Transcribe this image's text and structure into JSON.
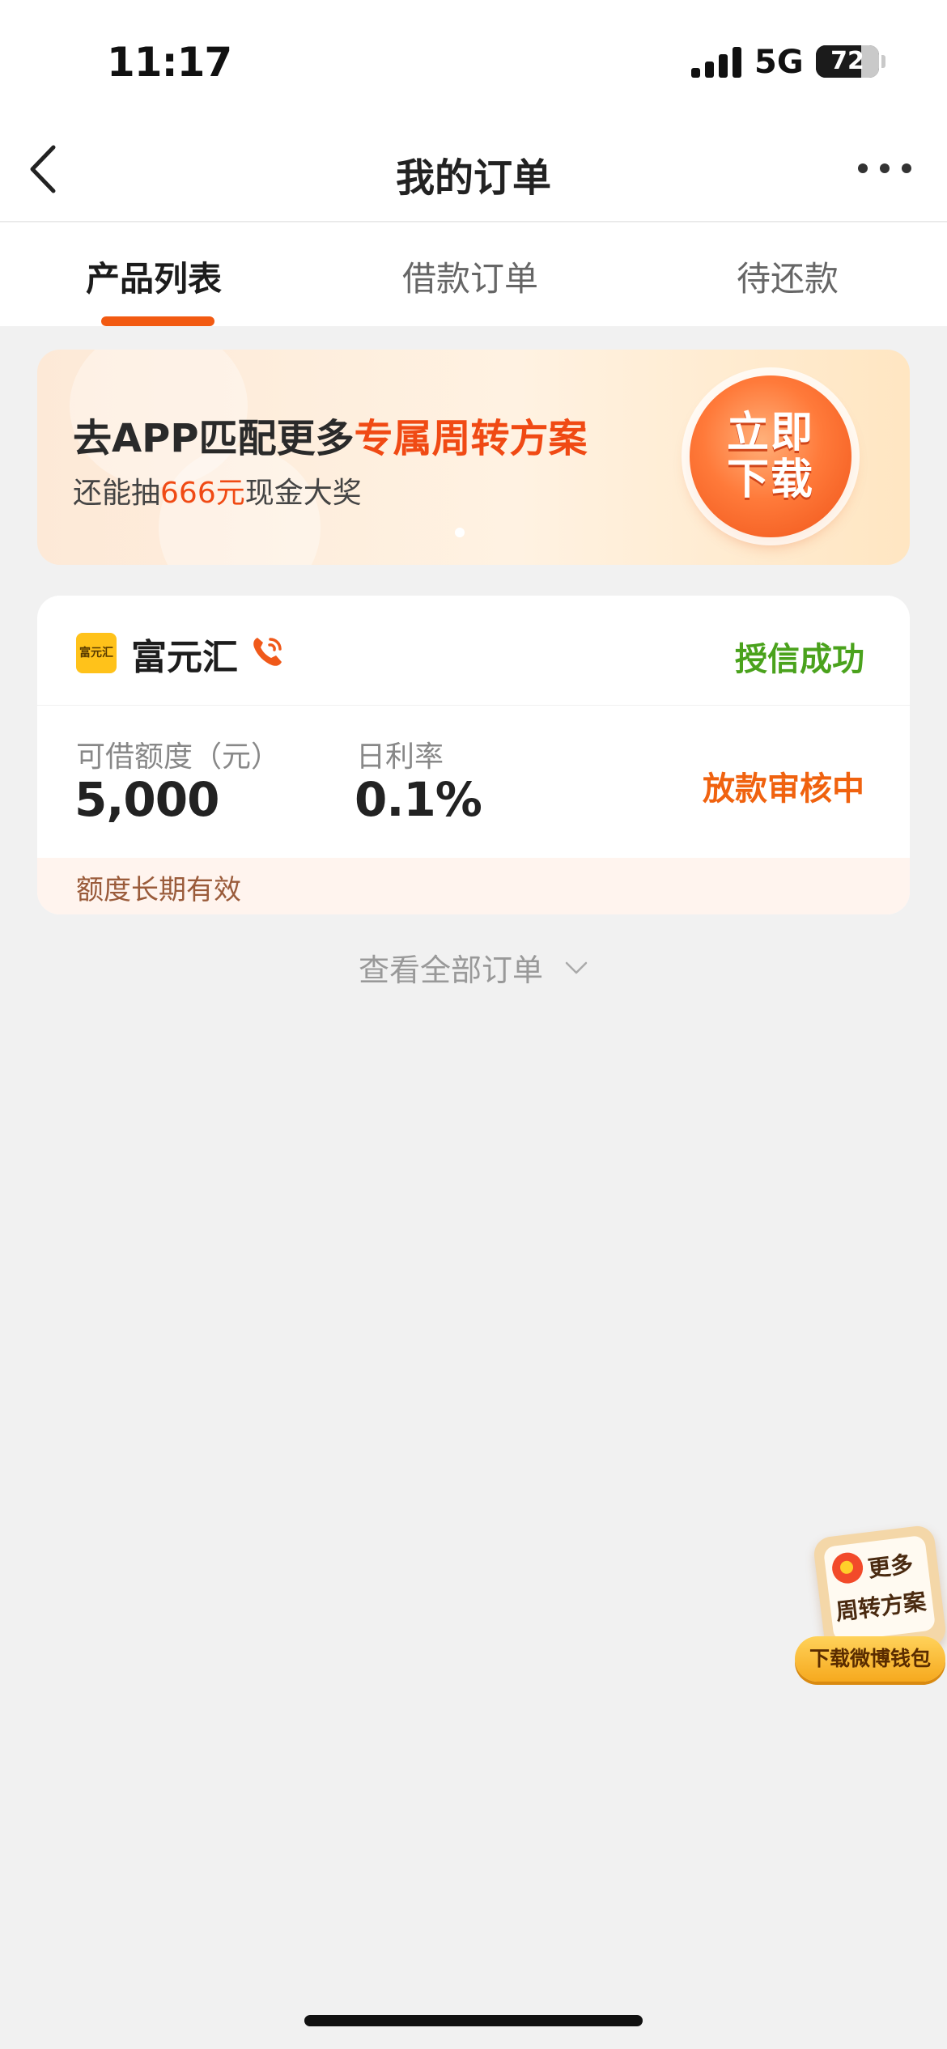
{
  "status_bar": {
    "time": "11:17",
    "network": "5G",
    "battery_percent": 72,
    "battery_label": "72"
  },
  "nav": {
    "title": "我的订单",
    "back_icon": "chevron-left-icon",
    "more_icon": "more-dots-icon"
  },
  "tabs": [
    {
      "label": "产品列表",
      "active": true
    },
    {
      "label": "借款订单",
      "active": false
    },
    {
      "label": "待还款",
      "active": false
    }
  ],
  "banner": {
    "title_prefix": "去APP匹配更多",
    "title_highlight": "专属周转方案",
    "subtitle_prefix": "还能抽",
    "subtitle_highlight": "666元",
    "subtitle_suffix": "现金大奖",
    "download_label": "立即下载",
    "accent_color": "#f04a14"
  },
  "product": {
    "logo_text": "富元汇",
    "name": "富元汇",
    "phone_icon": "phone-icon",
    "credit_status": "授信成功",
    "limit_label": "可借额度（元）",
    "limit_value": "5,000",
    "rate_label": "日利率",
    "rate_value": "0.1%",
    "loan_status": "放款审核中",
    "validity": "额度长期有效",
    "success_color": "#4aa21c",
    "pending_color": "#f0620f"
  },
  "view_all": {
    "label": "查看全部订单",
    "icon": "chevron-down-icon"
  },
  "float_promo": {
    "line1": "更多",
    "line2": "周转方案",
    "button": "下载微博钱包"
  }
}
